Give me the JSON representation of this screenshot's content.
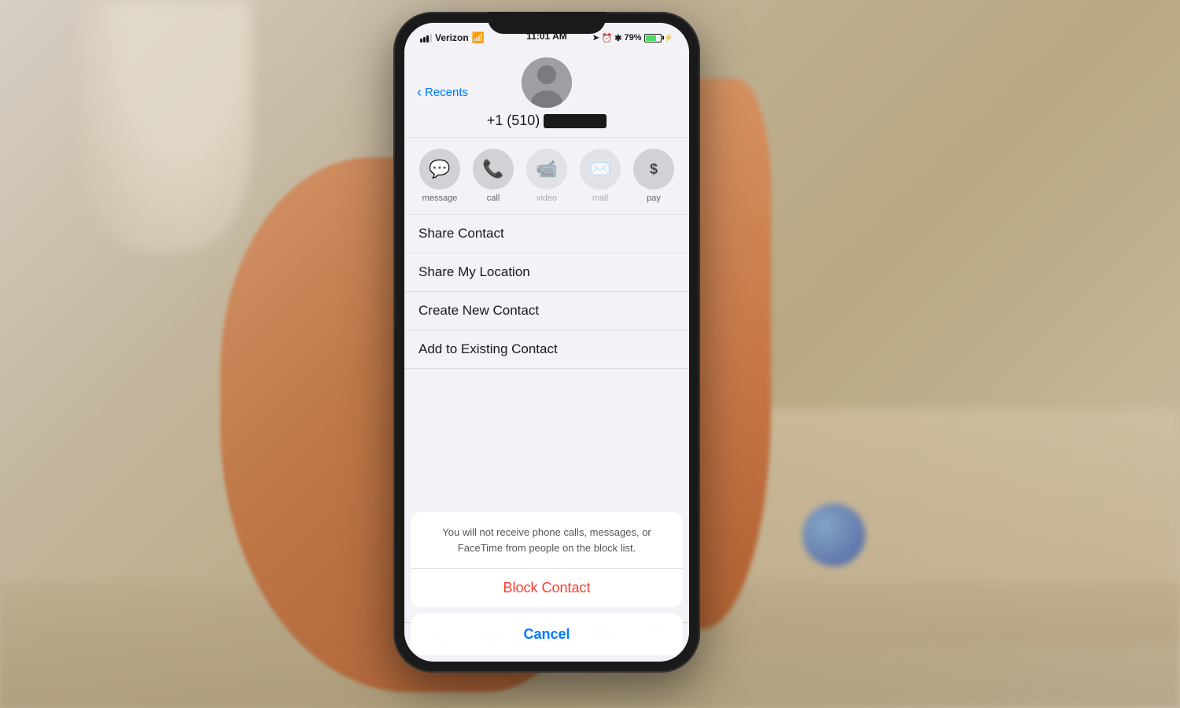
{
  "background": {
    "color": "#c8b49a"
  },
  "status_bar": {
    "carrier": "Verizon",
    "time": "11:01 AM",
    "battery_percent": "79%",
    "battery_color": "#4cd964"
  },
  "contact": {
    "back_label": "Recents",
    "phone_number_prefix": "+1 (510)",
    "phone_number_redacted": true
  },
  "action_buttons": [
    {
      "id": "message",
      "icon": "💬",
      "label": "message",
      "dimmed": false
    },
    {
      "id": "call",
      "icon": "📞",
      "label": "call",
      "dimmed": false
    },
    {
      "id": "video",
      "icon": "📹",
      "label": "video",
      "dimmed": true
    },
    {
      "id": "mail",
      "icon": "✉️",
      "label": "mail",
      "dimmed": true
    },
    {
      "id": "pay",
      "icon": "$",
      "label": "pay",
      "dimmed": false
    }
  ],
  "menu_items": [
    {
      "id": "share-contact",
      "label": "Share Contact"
    },
    {
      "id": "share-location",
      "label": "Share My Location"
    },
    {
      "id": "create-contact",
      "label": "Create New Contact"
    },
    {
      "id": "add-existing",
      "label": "Add to Existing Contact"
    }
  ],
  "alert": {
    "message": "You will not receive phone calls, messages, or FaceTime from people on the block list.",
    "block_label": "Block Contact",
    "cancel_label": "Cancel",
    "block_color": "#ff3b30",
    "cancel_color": "#007aff"
  },
  "tab_bar": {
    "items": [
      {
        "id": "favorites",
        "label": "Favorites",
        "icon": "⭐"
      },
      {
        "id": "recents",
        "label": "Recents",
        "icon": "🕐"
      },
      {
        "id": "contacts",
        "label": "Contacts",
        "icon": "👤"
      },
      {
        "id": "keypad",
        "label": "Keypad",
        "icon": "⌨️"
      },
      {
        "id": "voicemail",
        "label": "Voicemail",
        "icon": "📩"
      }
    ]
  }
}
